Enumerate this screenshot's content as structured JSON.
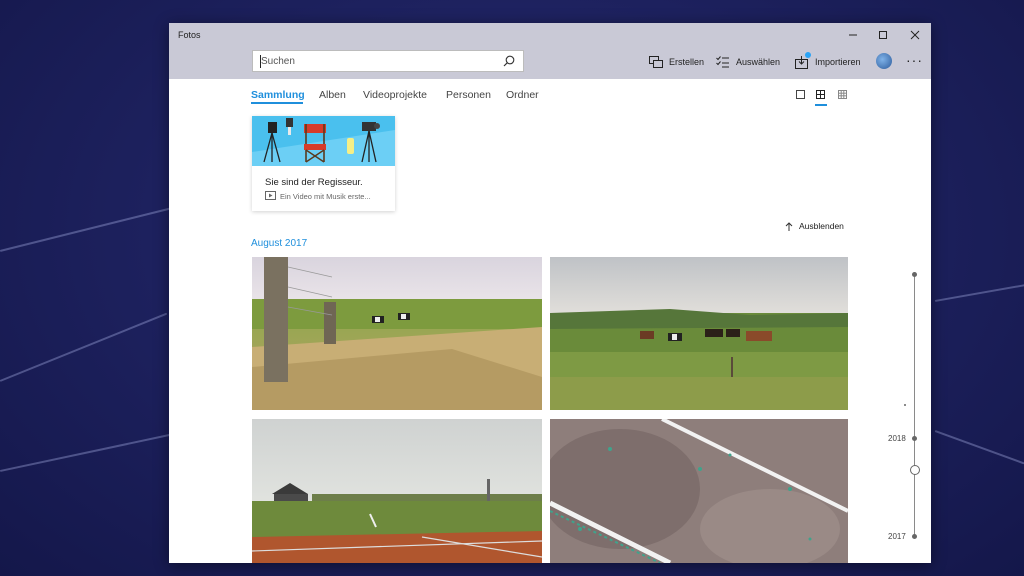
{
  "window": {
    "app_title": "Fotos",
    "controls": {
      "minimize_icon": "minimize-icon",
      "maximize_icon": "maximize-icon",
      "close_icon": "close-icon"
    }
  },
  "search": {
    "placeholder": "Suchen",
    "value": ""
  },
  "toolbar": {
    "create_label": "Erstellen",
    "select_label": "Auswählen",
    "import_label": "Importieren",
    "more_label": "···"
  },
  "tabs": [
    {
      "label": "Sammlung",
      "active": true
    },
    {
      "label": "Alben",
      "active": false
    },
    {
      "label": "Videoprojekte",
      "active": false
    },
    {
      "label": "Personen",
      "active": false
    },
    {
      "label": "Ordner",
      "active": false
    }
  ],
  "promo": {
    "title": "Sie sind der Regisseur.",
    "subtitle": "Ein Video mit Musik erste..."
  },
  "collection": {
    "hide_label": "Ausblenden",
    "month_label": "August 2017"
  },
  "timeline": {
    "years": [
      "2018",
      "2017"
    ]
  },
  "colors": {
    "accent": "#1f8fdc",
    "titlebar": "#c9c9d6",
    "notification": "#2aa3f5"
  }
}
